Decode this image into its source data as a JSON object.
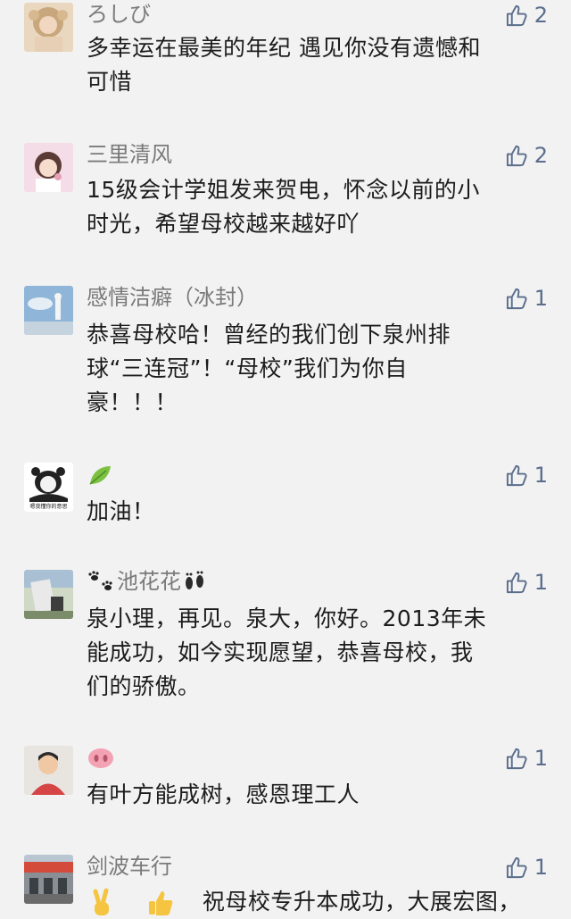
{
  "comments": [
    {
      "name": "ろしび",
      "likes": "2",
      "text_lines": [
        "多幸运在最美的年纪 遇见你没有遗憾和",
        "可惜"
      ],
      "avatar": "avatar-portrait-icon"
    },
    {
      "name": "三里清风",
      "likes": "2",
      "text_lines": [
        "15级会计学姐发来贺电，怀念以前的小",
        "时光，希望母校越来越好吖"
      ],
      "avatar": "avatar-girl-icon"
    },
    {
      "name": "感情洁癖（冰封）",
      "likes": "1",
      "text_lines": [
        "恭喜母校哈！曾经的我们创下泉州排",
        "球“三连冠”！“母校”我们为你自",
        "豪！！！"
      ],
      "avatar": "avatar-sky-icon"
    },
    {
      "name": "",
      "likes": "1",
      "text_lines": [
        "加油！"
      ],
      "avatar": "avatar-panda-meme-icon",
      "avatar_caption": "嗯我懂你的意思",
      "name_emoji": "leaf-icon"
    },
    {
      "name": "池花花",
      "likes": "1",
      "text_lines": [
        "泉小理，再见。泉大，你好。2013年未",
        "能成功，如今实现愿望，恭喜母校，我",
        "们的骄傲。"
      ],
      "avatar": "avatar-statue-icon",
      "name_prefix_emoji": "paw-prints-icon",
      "name_suffix_emoji": "footprints-icon"
    },
    {
      "name": "",
      "likes": "1",
      "text_lines": [
        "有叶方能成树，感恩理工人"
      ],
      "avatar": "avatar-man-icon",
      "name_emoji": "pig-nose-icon"
    },
    {
      "name": "剑波车行",
      "likes": "1",
      "text_lines": [
        "祝母校专升本成功，大展宏图，"
      ],
      "avatar": "avatar-shop-icon",
      "text_prefix_emojis": [
        "victory-hand-icon",
        "thumbs-up-icon"
      ]
    }
  ],
  "colors": {
    "background": "#f2f2f2",
    "name": "#7a7a7a",
    "text": "#1c1c1c",
    "like": "#5a6d8c"
  }
}
